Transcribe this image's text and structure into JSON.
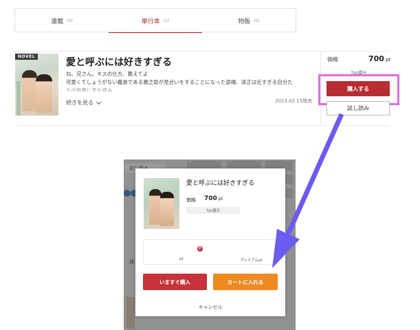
{
  "tabs": [
    {
      "label": "連載",
      "count": "(0)"
    },
    {
      "label": "単行本",
      "count": "(1)"
    },
    {
      "label": "物販",
      "count": "(0)"
    }
  ],
  "book": {
    "badge": "NOVEL",
    "title": "愛と呼ぶには好きすぎる",
    "desc_line1": "ね、兄さん。キスの仕方、教えてよ",
    "desc_line2": "可愛くてしょうがない義弟である雅之助が見合いをすることになった途端、清正は近すぎる自分た",
    "desc_line3": "ちの距離に気を揉み……",
    "more": "続きを見る",
    "release": "2023.02.15発売",
    "price_label": "価格",
    "price": "700",
    "price_unit": "pt",
    "reward": "7pt還元",
    "buy": "購入する",
    "trial": "試し読み"
  },
  "bg_page": {
    "tab_label": "試し読み",
    "side_label": "通"
  },
  "modal": {
    "title": "愛と呼ぶには好きすぎる",
    "price_label": "価格",
    "price": "700",
    "price_unit": "pt",
    "reward": "7pt還元",
    "badge": "P",
    "pt_label": "pt",
    "premium_label": "プレミアムpt",
    "buy_now": "いますぐ購入",
    "add_cart": "カートに入れる",
    "cancel": "キャンセル"
  },
  "colors": {
    "accent_red": "#b82d32",
    "highlight": "#e56be2",
    "arrow": "#6a5cf0",
    "cart_orange": "#ee8a22"
  }
}
